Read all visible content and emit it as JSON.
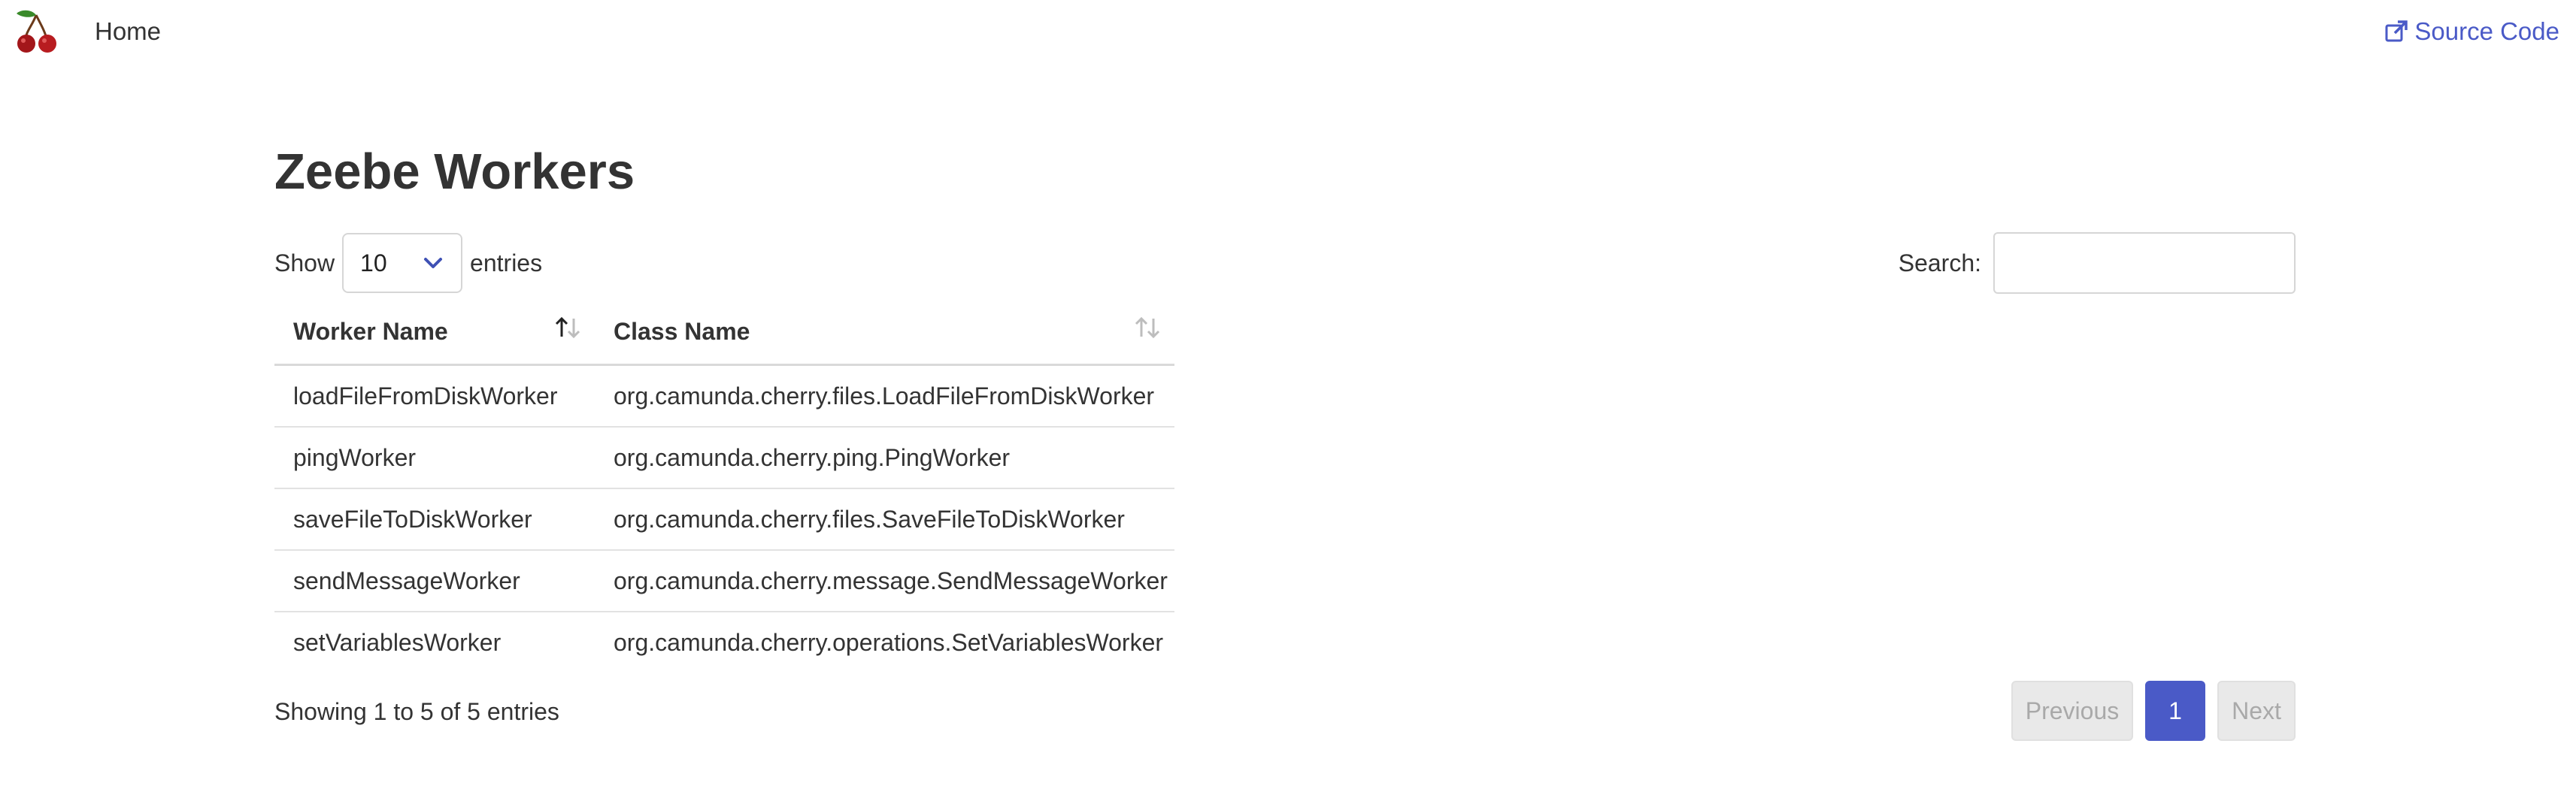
{
  "navbar": {
    "logo_icon": "cherry-icon",
    "home_label": "Home",
    "source_code_label": "Source Code",
    "source_code_icon": "external-link-icon",
    "link_color": "#4a5ac7"
  },
  "page": {
    "title": "Zeebe Workers"
  },
  "length_control": {
    "show_label": "Show",
    "selected_value": "10",
    "entries_label": "entries",
    "chevron_icon": "chevron-down-icon"
  },
  "search": {
    "label": "Search:",
    "value": "",
    "placeholder": ""
  },
  "table": {
    "columns": [
      {
        "label": "Worker Name",
        "sort": "ascending"
      },
      {
        "label": "Class Name",
        "sort": "none"
      }
    ],
    "rows": [
      {
        "worker": "loadFileFromDiskWorker",
        "class": "org.camunda.cherry.files.LoadFileFromDiskWorker"
      },
      {
        "worker": "pingWorker",
        "class": "org.camunda.cherry.ping.PingWorker"
      },
      {
        "worker": "saveFileToDiskWorker",
        "class": "org.camunda.cherry.files.SaveFileToDiskWorker"
      },
      {
        "worker": "sendMessageWorker",
        "class": "org.camunda.cherry.message.SendMessageWorker"
      },
      {
        "worker": "setVariablesWorker",
        "class": "org.camunda.cherry.operations.SetVariablesWorker"
      }
    ]
  },
  "footer": {
    "info": "Showing 1 to 5 of 5 entries",
    "pagination": {
      "previous_label": "Previous",
      "current_page": "1",
      "next_label": "Next",
      "active_color": "#4a5ac7"
    }
  }
}
